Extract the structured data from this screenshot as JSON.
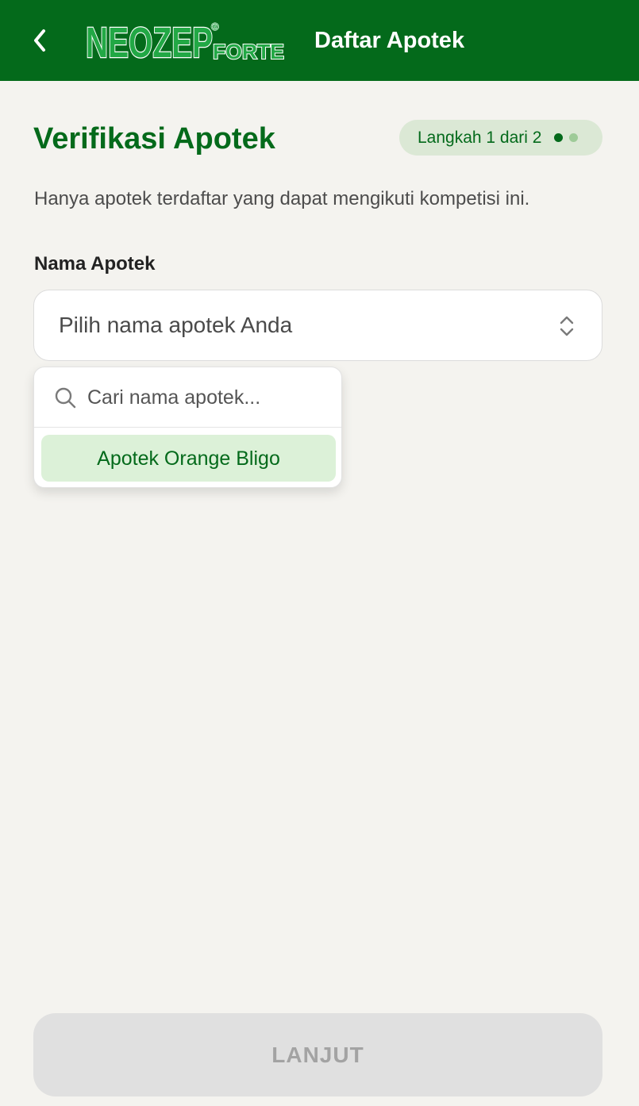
{
  "header": {
    "back_icon": "chevron-left-icon",
    "logo_main": "NEOZEP",
    "logo_sub": "FORTE",
    "logo_mark": "®",
    "title": "Daftar Apotek"
  },
  "main": {
    "title": "Verifikasi Apotek",
    "step_badge": "Langkah 1 dari 2",
    "step_current": 1,
    "step_total": 2,
    "subtitle": "Hanya apotek terdaftar yang dapat mengikuti kompetisi ini.",
    "field_label": "Nama Apotek",
    "select_placeholder": "Pilih nama apotek Anda",
    "select_icon": "chevron-up-down-icon"
  },
  "dropdown": {
    "search_placeholder": "Cari nama apotek...",
    "search_value": "",
    "search_icon": "search-icon",
    "options": [
      {
        "label": "Apotek Orange Bligo",
        "highlighted": true
      }
    ]
  },
  "footer": {
    "continue_label": "LANJUT",
    "continue_enabled": false
  },
  "colors": {
    "brand_green": "#046a1b",
    "logo_green": "#22a845",
    "background": "#f4f3ef",
    "badge_bg": "#dbe8d5",
    "option_bg": "#dcf1d8",
    "disabled_bg": "#e0e0e0",
    "disabled_text": "#a3a3a3"
  }
}
